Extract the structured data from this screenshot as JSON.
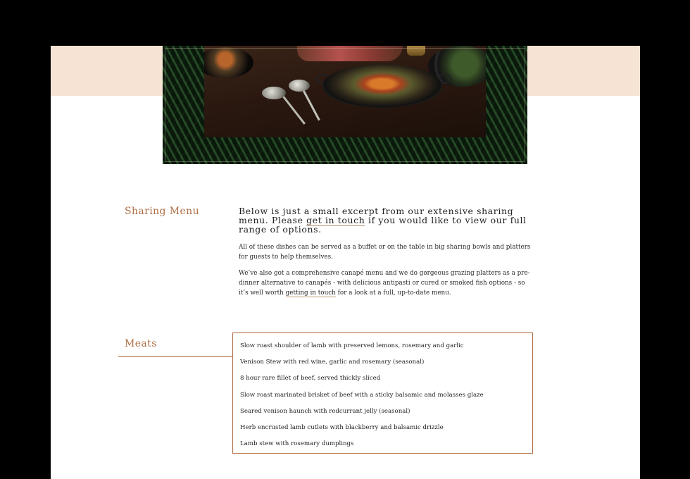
{
  "intro": {
    "title": "Sharing Menu",
    "lead_before": "Below is just a small excerpt from our extensive sharing menu. Please ",
    "lead_link": "get in touch",
    "lead_after": " if you would like to view our full range of options.",
    "p1": "All of these dishes can be served as a buffet or on the table in big sharing bowls and platters for guests to help themselves.",
    "p2_before": "We’ve also got a comprehensive canapé menu and we do gorgeous grazing platters as a pre-dinner alternative to canapés - with delicious antipasti or cured or smoked fish options - so it’s well worth ",
    "p2_link": "getting in touch",
    "p2_after": " for a look at a full, up-to-date menu."
  },
  "meats": {
    "title": "Meats",
    "items": [
      "Slow roast shoulder of lamb with preserved lemons, rosemary and garlic",
      "Venison Stew with red wine, garlic and rosemary (seasonal)",
      "8 hour rare fillet of beef, served thickly sliced",
      "Slow roast marinated brisket of beef with a sticky balsamic and molasses glaze",
      "Seared venison haunch with redcurrant jelly (seasonal)",
      "Herb encrusted lamb cutlets with blackberry and balsamic drizzle",
      "Lamb stew with rosemary dumplings"
    ]
  },
  "colors": {
    "accent": "#b06f44",
    "peach_band": "#f6e3d3",
    "text": "#1e1e1e"
  }
}
